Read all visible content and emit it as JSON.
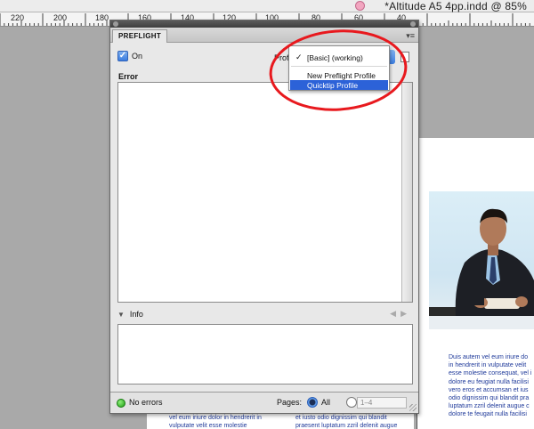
{
  "document": {
    "title": "*Altitude A5 4pp.indd @ 85%"
  },
  "ruler": {
    "numbers": [
      "220",
      "200",
      "180",
      "160",
      "140",
      "120",
      "100",
      "80",
      "60",
      "40"
    ]
  },
  "panel": {
    "tab_label": "PREFLIGHT",
    "menu_icon": "panel-menu-icon",
    "on_label": "On",
    "profile_label": "Profil",
    "error_label": "Error",
    "info_label": "Info",
    "status_text": "No errors",
    "pages_label": "Pages:",
    "all_label": "All",
    "range_value": "1–4"
  },
  "dropdown": {
    "checkmark": "✓",
    "items": [
      "[Basic] (working)",
      "New Preflight Profile",
      "Quicktip Profile"
    ]
  },
  "page": {
    "right_column": "Duis autem vel eum iriure do in hendrerit in vulputate velit esse molestie consequat, vel i dolore eu feugiat nulla facilisi vero eros et accumsan et ius odio dignissim qui blandit pra luptatum zzril delenit augue c dolore te feugait nulla facilisi",
    "bottom_left": "vel eum iriure dolor in hendrerit in vulputate velit esse molestie",
    "bottom_mid": "et iusto odio dignissim qui blandit praesent luptatum zzril delenit augue"
  },
  "colors": {
    "annotation": "#e8191e",
    "selection": "#2c62d8",
    "text_blue": "#1f3a9a"
  }
}
